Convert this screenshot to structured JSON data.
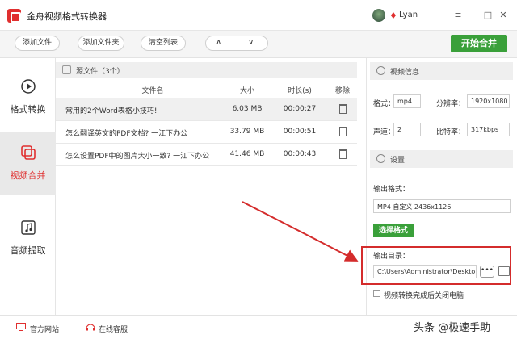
{
  "app": {
    "title": "金舟视频格式转换器",
    "username": "Lyan"
  },
  "window_controls": {
    "menu": "≡",
    "minimize": "−",
    "maximize": "□",
    "close": "✕"
  },
  "toolbar": {
    "add_file": "添加文件",
    "add_folder": "添加文件夹",
    "clear_list": "清空列表",
    "up": "∧",
    "down": "∨",
    "start": "开始合并"
  },
  "sidebar": {
    "items": [
      {
        "label": "格式转换",
        "icon": "play-circle-icon",
        "active": false
      },
      {
        "label": "视频合并",
        "icon": "merge-icon",
        "active": true
      },
      {
        "label": "音频提取",
        "icon": "music-note-icon",
        "active": false
      }
    ]
  },
  "file_list": {
    "title": "源文件（3个）",
    "columns": {
      "name": "文件名",
      "size": "大小",
      "duration": "时长(s)",
      "remove": "移除"
    },
    "rows": [
      {
        "name": "常用的2个Word表格小技巧!",
        "size": "6.03 MB",
        "duration": "00:00:27"
      },
      {
        "name": "怎么翻译英文的PDF文档? 一江下办公",
        "size": "33.79 MB",
        "duration": "00:00:51"
      },
      {
        "name": "怎么设置PDF中的图片大小一致? 一江下办公",
        "size": "41.46 MB",
        "duration": "00:00:43"
      }
    ]
  },
  "video_info": {
    "title": "视频信息",
    "format_label": "格式：",
    "format": "mp4",
    "resolution_label": "分辨率：",
    "resolution": "1920x1080",
    "channels_label": "声道：",
    "channels": "2",
    "bitrate_label": "比特率：",
    "bitrate": "317kbps"
  },
  "settings": {
    "title": "设置",
    "output_format_label": "输出格式：",
    "output_format": "MP4 自定义 2436x1126",
    "choose_format": "选择格式",
    "output_dir_label": "输出目录：",
    "output_dir": "C:\\Users\\Administrator\\Deskto",
    "browse": "•••",
    "shutdown_label": "视频转换完成后关闭电脑"
  },
  "statusbar": {
    "website": "官方网站",
    "support": "在线客服"
  },
  "watermark": "头条 @极速手助",
  "colors": {
    "accent_green": "#3aa03a",
    "brand_red": "#e02f2f",
    "highlight_red": "#d42c2c"
  }
}
